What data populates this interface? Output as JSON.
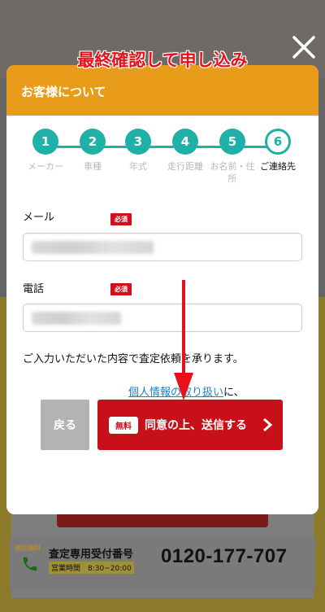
{
  "overlay": {
    "title": "最終確認して申し込み"
  },
  "modal": {
    "header": "お客様について",
    "steps": [
      {
        "number": "1",
        "label": "メーカー"
      },
      {
        "number": "2",
        "label": "車種"
      },
      {
        "number": "3",
        "label": "年式"
      },
      {
        "number": "4",
        "label": "走行距離"
      },
      {
        "number": "5",
        "label": "お名前・住所"
      },
      {
        "number": "6",
        "label": "ご連絡先"
      }
    ],
    "current_step": 6,
    "email": {
      "label": "メール",
      "required": "必須",
      "value": ""
    },
    "phone": {
      "label": "電話",
      "required": "必須",
      "value": ""
    },
    "note": "ご入力いただいた内容で査定依頼を承ります。",
    "privacy_link": "個人情報の取り扱い",
    "privacy_suffix": "に、",
    "back_label": "戻る",
    "free_badge": "無料",
    "submit_label": "同意の上、送信する"
  },
  "footer": {
    "free_call": "通話無料",
    "label": "査定専用受付番号",
    "hours": "営業時間　8:30~20:00",
    "phone": "0120-177-707"
  },
  "colors": {
    "header": "#e89c1a",
    "step_accent": "#1fb1a8",
    "submit": "#c8101a",
    "annotation_arrow": "#e8101a"
  }
}
